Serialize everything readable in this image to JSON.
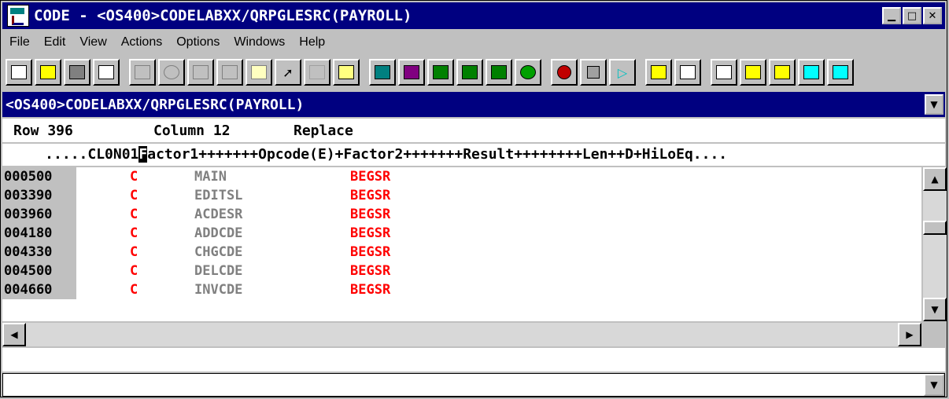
{
  "window": {
    "title": "CODE - <OS400>CODELABXX/QRPGLESRC(PAYROLL)",
    "minimize": "▁",
    "maximize": "□",
    "close": "✕"
  },
  "menu": [
    "File",
    "Edit",
    "View",
    "Actions",
    "Options",
    "Windows",
    "Help"
  ],
  "pathbar": {
    "path": "<OS400>CODELABXX/QRPGLESRC(PAYROLL)"
  },
  "status": {
    "row": "Row 396",
    "column": "Column 12",
    "mode": "Replace"
  },
  "ruler": {
    "before": "     .....CL0N01",
    "cursor": "F",
    "after": "actor1+++++++Opcode(E)+Factor2+++++++Result++++++++Len++D+HiLoEq...."
  },
  "lines": [
    {
      "seq": "000500",
      "spec": "C",
      "factor1": "MAIN",
      "opcode": "BEGSR"
    },
    {
      "seq": "003390",
      "spec": "C",
      "factor1": "EDITSL",
      "opcode": "BEGSR"
    },
    {
      "seq": "003960",
      "spec": "C",
      "factor1": "ACDESR",
      "opcode": "BEGSR"
    },
    {
      "seq": "004180",
      "spec": "C",
      "factor1": "ADDCDE",
      "opcode": "BEGSR"
    },
    {
      "seq": "004330",
      "spec": "C",
      "factor1": "CHGCDE",
      "opcode": "BEGSR"
    },
    {
      "seq": "004500",
      "spec": "C",
      "factor1": "DELCDE",
      "opcode": "BEGSR"
    },
    {
      "seq": "004660",
      "spec": "C",
      "factor1": "INVCDE",
      "opcode": "BEGSR"
    }
  ],
  "colors": {
    "title_bg": "#000080",
    "keyword": "#ff0000",
    "factor": "#808080",
    "chrome": "#c0c0c0"
  },
  "toolbar_icons": [
    "new-file-icon",
    "open-folder-icon",
    "save-icon",
    "print-icon",
    "cut-icon",
    "undo-icon",
    "scissors-icon",
    "copy-icon",
    "paste-icon",
    "select-arrow-icon",
    "blank-icon",
    "flashlight-icon",
    "compile-icon",
    "program-verify-icon",
    "build-icon",
    "build-2-icon",
    "build-3-icon",
    "debug-bug-icon",
    "record-icon",
    "stop-icon",
    "play-icon",
    "format-icon",
    "calculator-icon",
    "layout-icon",
    "forward-icon",
    "back-icon",
    "export-icon",
    "import-icon"
  ]
}
